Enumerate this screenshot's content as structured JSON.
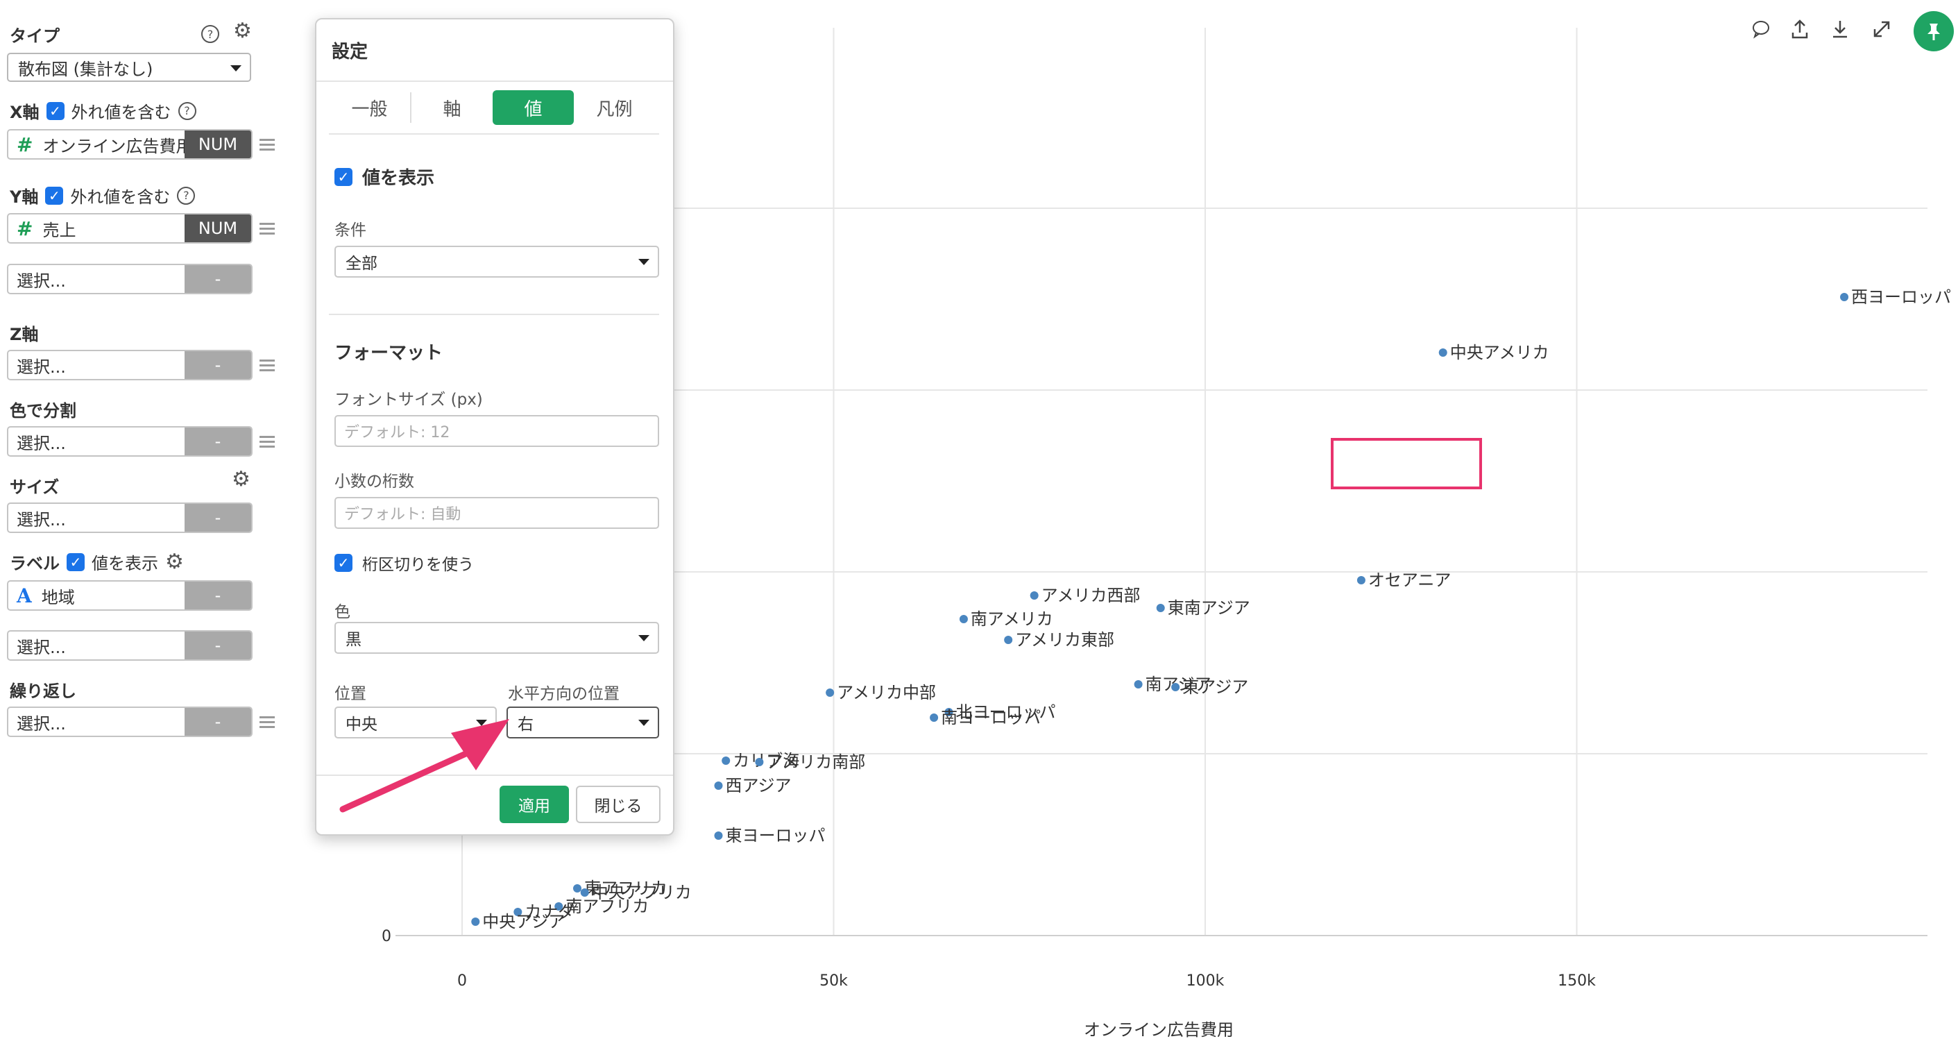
{
  "left_panel": {
    "type_label": "タイプ",
    "type_value": "散布図 (集計なし)",
    "x_axis_label": "X軸",
    "x_include_outliers": "外れ値を含む",
    "x_field": "オンライン広告費用",
    "x_field_badge": "NUM",
    "y_axis_label": "Y軸",
    "y_include_outliers": "外れ値を含む",
    "y_field": "売上",
    "y_field_badge": "NUM",
    "extra_select": "選択...",
    "extra_badge": "-",
    "z_axis_label": "Z軸",
    "z_select": "選択...",
    "z_badge": "-",
    "color_label": "色で分割",
    "color_select": "選択...",
    "color_badge": "-",
    "size_label": "サイズ",
    "size_select": "選択...",
    "size_badge": "-",
    "label_label": "ラベル",
    "label_show_values": "値を表示",
    "label_field": "地域",
    "label_field_badge": "-",
    "label_extra_select": "選択...",
    "label_extra_badge": "-",
    "repeat_label": "繰り返し",
    "repeat_select": "選択...",
    "repeat_badge": "-"
  },
  "dialog": {
    "title": "設定",
    "tabs": [
      "一般",
      "軸",
      "値",
      "凡例"
    ],
    "active_tab": "値",
    "show_values": "値を表示",
    "condition_label": "条件",
    "condition_value": "全部",
    "format_heading": "フォーマット",
    "font_size_label": "フォントサイズ (px)",
    "font_size_placeholder": "デフォルト: 12",
    "decimals_label": "小数の桁数",
    "decimals_placeholder": "デフォルト: 自動",
    "thousands_sep": "桁区切りを使う",
    "color_label": "色",
    "color_value": "黒",
    "position_label": "位置",
    "position_value": "中央",
    "hpos_label": "水平方向の位置",
    "hpos_value": "右",
    "apply": "適用",
    "close": "閉じる"
  },
  "colors": {
    "accent_green": "#1fa463",
    "point_blue": "#4a86c0",
    "highlight_pink": "#e8336d",
    "checkbox_blue": "#1a73e8"
  },
  "chart_data": {
    "type": "scatter",
    "xlabel": "オンライン広告費用",
    "ylabel": "",
    "x_ticks": [
      "0",
      "50k",
      "100k",
      "150k"
    ],
    "y_ticks": [
      "0"
    ],
    "xlim": [
      -10000,
      197000
    ],
    "grid": true,
    "points": [
      {
        "label": "西ヨーロッパ",
        "x": 186000,
        "y": 4600
      },
      {
        "label": "中央アメリカ",
        "x": 132000,
        "y": 4200
      },
      {
        "label": "オセアニア",
        "x": 121000,
        "y": 2560
      },
      {
        "label": "アメリカ西部",
        "x": 77000,
        "y": 2450
      },
      {
        "label": "東南アジア",
        "x": 94000,
        "y": 2360
      },
      {
        "label": "南アメリカ",
        "x": 67500,
        "y": 2280
      },
      {
        "label": "アメリカ東部",
        "x": 73500,
        "y": 2130
      },
      {
        "label": "アメリカ中部",
        "x": 49500,
        "y": 1750
      },
      {
        "label": "南アジア",
        "x": 91000,
        "y": 1810
      },
      {
        "label": "東アジア",
        "x": 96000,
        "y": 1790
      },
      {
        "label": "北ヨーロッパ",
        "x": 65500,
        "y": 1610
      },
      {
        "label": "南ヨーロッパ",
        "x": 63500,
        "y": 1570
      },
      {
        "label": "カリブ海",
        "x": 35500,
        "y": 1260
      },
      {
        "label": "アメリカ南部",
        "x": 40000,
        "y": 1250
      },
      {
        "label": "西アジア",
        "x": 34500,
        "y": 1080
      },
      {
        "label": "東ヨーロッパ",
        "x": 34500,
        "y": 720
      },
      {
        "label": "東アフリカ",
        "x": 15500,
        "y": 340
      },
      {
        "label": "中央アフリカ",
        "x": 16500,
        "y": 310
      },
      {
        "label": "南アフリカ",
        "x": 13000,
        "y": 210
      },
      {
        "label": "カナダ",
        "x": 7500,
        "y": 170
      },
      {
        "label": "中央アジア",
        "x": 1800,
        "y": 100
      }
    ]
  }
}
